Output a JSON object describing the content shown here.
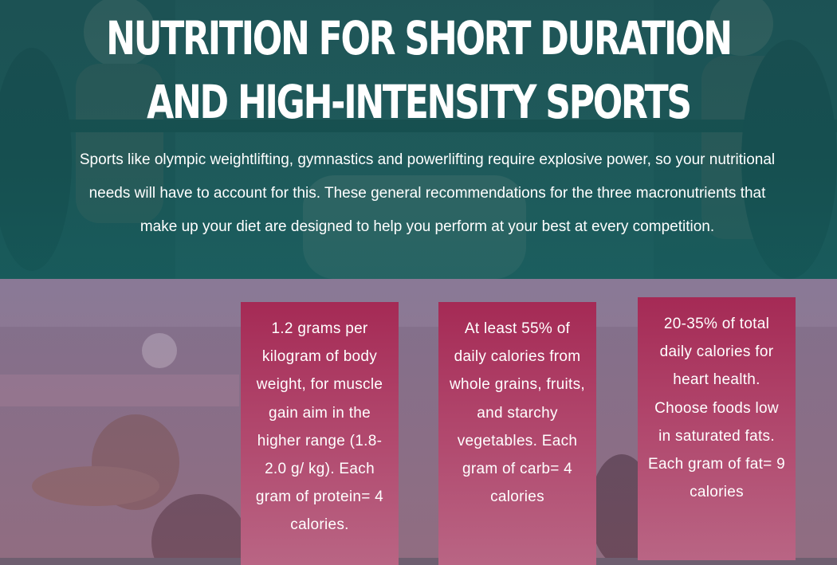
{
  "header": {
    "title_line1": "NUTRITION FOR SHORT DURATION",
    "title_line2": "AND HIGH-INTENSITY SPORTS",
    "intro": "Sports like olympic weightlifting, gymnastics and powerlifting require explosive power, so your nutritional needs will have to account for this.  These general recommendations for the three macronutrients that make up your diet are designed to help you perform at your best at every competition."
  },
  "cards": [
    {
      "text": "1.2 grams per kilogram of body weight, for muscle gain aim in the higher range (1.8-2.0 g/ kg). Each gram of protein= 4 calories."
    },
    {
      "text": "At least 55% of daily calories from whole grains, fruits, and starchy vegetables. Each gram of carb= 4 calories"
    },
    {
      "text": "20-35% of total daily calories for heart health. Choose foods low in saturated fats. Each gram of fat= 9 calories"
    }
  ],
  "colors": {
    "hero_tint": "#1f6766",
    "card_top": "#a52a55",
    "card_bottom": "#b96584",
    "lower_tint": "#7f6d82"
  }
}
